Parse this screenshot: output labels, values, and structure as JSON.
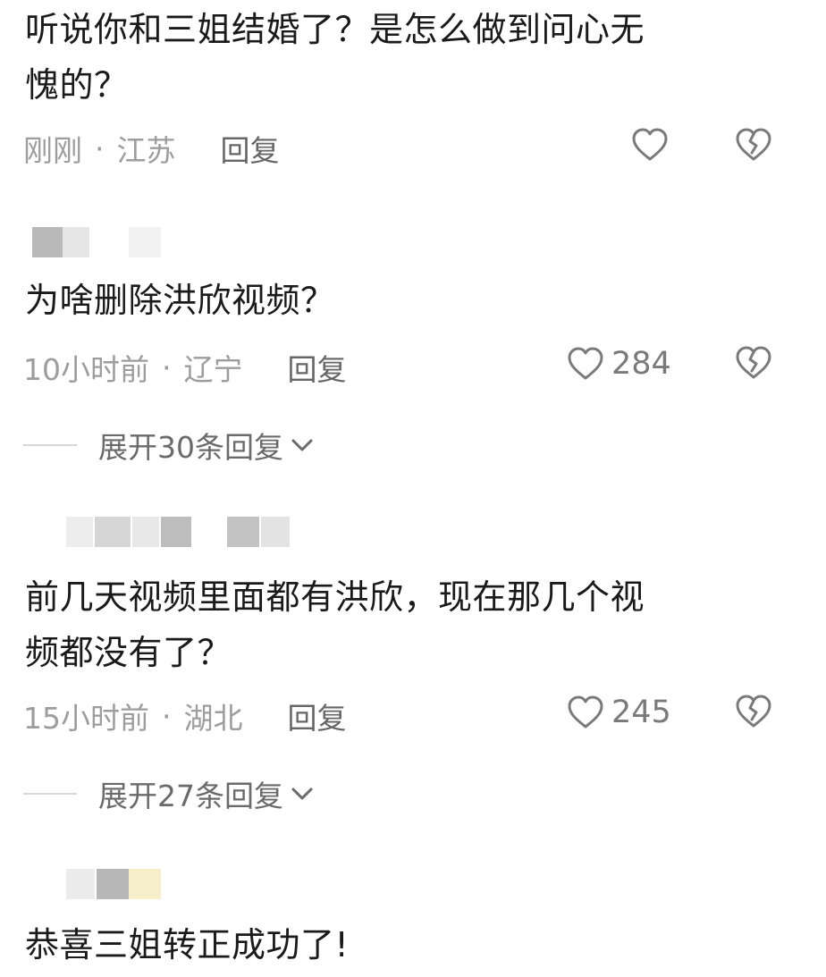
{
  "comments": [
    {
      "text_lines": [
        "听说你和三姐结婚了？是怎么做到问心无",
        "愧的？"
      ],
      "time": "刚刚",
      "location": "江苏",
      "reply_label": "回复",
      "likes": ""
    },
    {
      "text_lines": [
        "为啥删除洪欣视频？"
      ],
      "time": "10小时前",
      "location": "辽宁",
      "reply_label": "回复",
      "likes": "284",
      "expand_label": "展开30条回复"
    },
    {
      "text_lines": [
        "前几天视频里面都有洪欣，现在那几个视",
        "频都没有了？"
      ],
      "time": "15小时前",
      "location": "湖北",
      "reply_label": "回复",
      "likes": "245",
      "expand_label": "展开27条回复"
    },
    {
      "text_lines": [
        "恭喜三姐转正成功了!"
      ]
    }
  ],
  "separator": "·",
  "icons": {
    "like": "heart-outline-icon",
    "dislike": "broken-heart-icon",
    "expand": "chevron-down-icon"
  },
  "colors": {
    "text": "#1a1a1a",
    "meta": "#9d9d9d",
    "reply": "#666666",
    "icon": "#7a7a7a"
  }
}
